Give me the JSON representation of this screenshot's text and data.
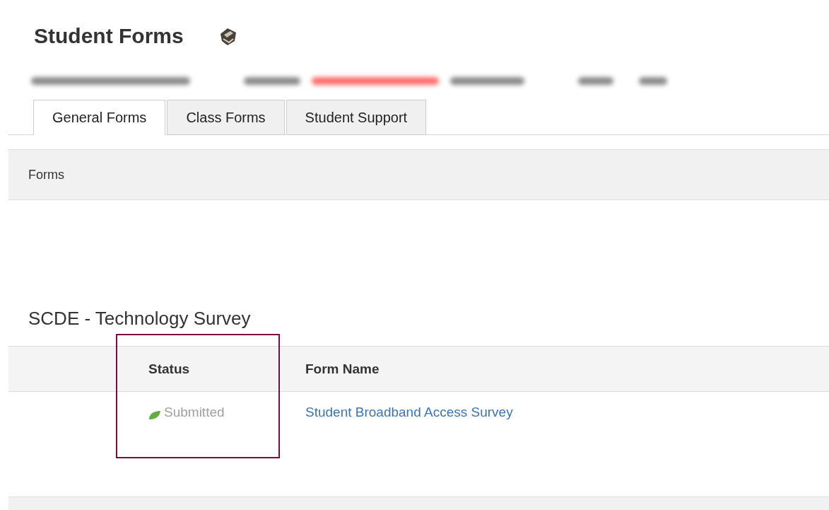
{
  "page_title": "Student Forms",
  "redacted_fields": [
    {
      "color": "#8a8a8a"
    },
    {
      "color": "#8a8a8a"
    },
    {
      "color": "#ff6b6b"
    },
    {
      "color": "#8a8a8a"
    },
    {
      "color": "#8a8a8a"
    },
    {
      "color": "#8a8a8a"
    }
  ],
  "tabs": [
    {
      "label": "General Forms",
      "selected": true
    },
    {
      "label": "Class Forms",
      "selected": false
    },
    {
      "label": "Student Support",
      "selected": false
    }
  ],
  "panel_header": "Forms",
  "section_title": "SCDE - Technology Survey",
  "table": {
    "columns": [
      {
        "label": "Status",
        "highlighted": true
      },
      {
        "label": "Form Name",
        "highlighted": false
      }
    ],
    "rows": [
      {
        "status": "Submitted",
        "form_name": "Student Broadband Access Survey"
      }
    ]
  }
}
